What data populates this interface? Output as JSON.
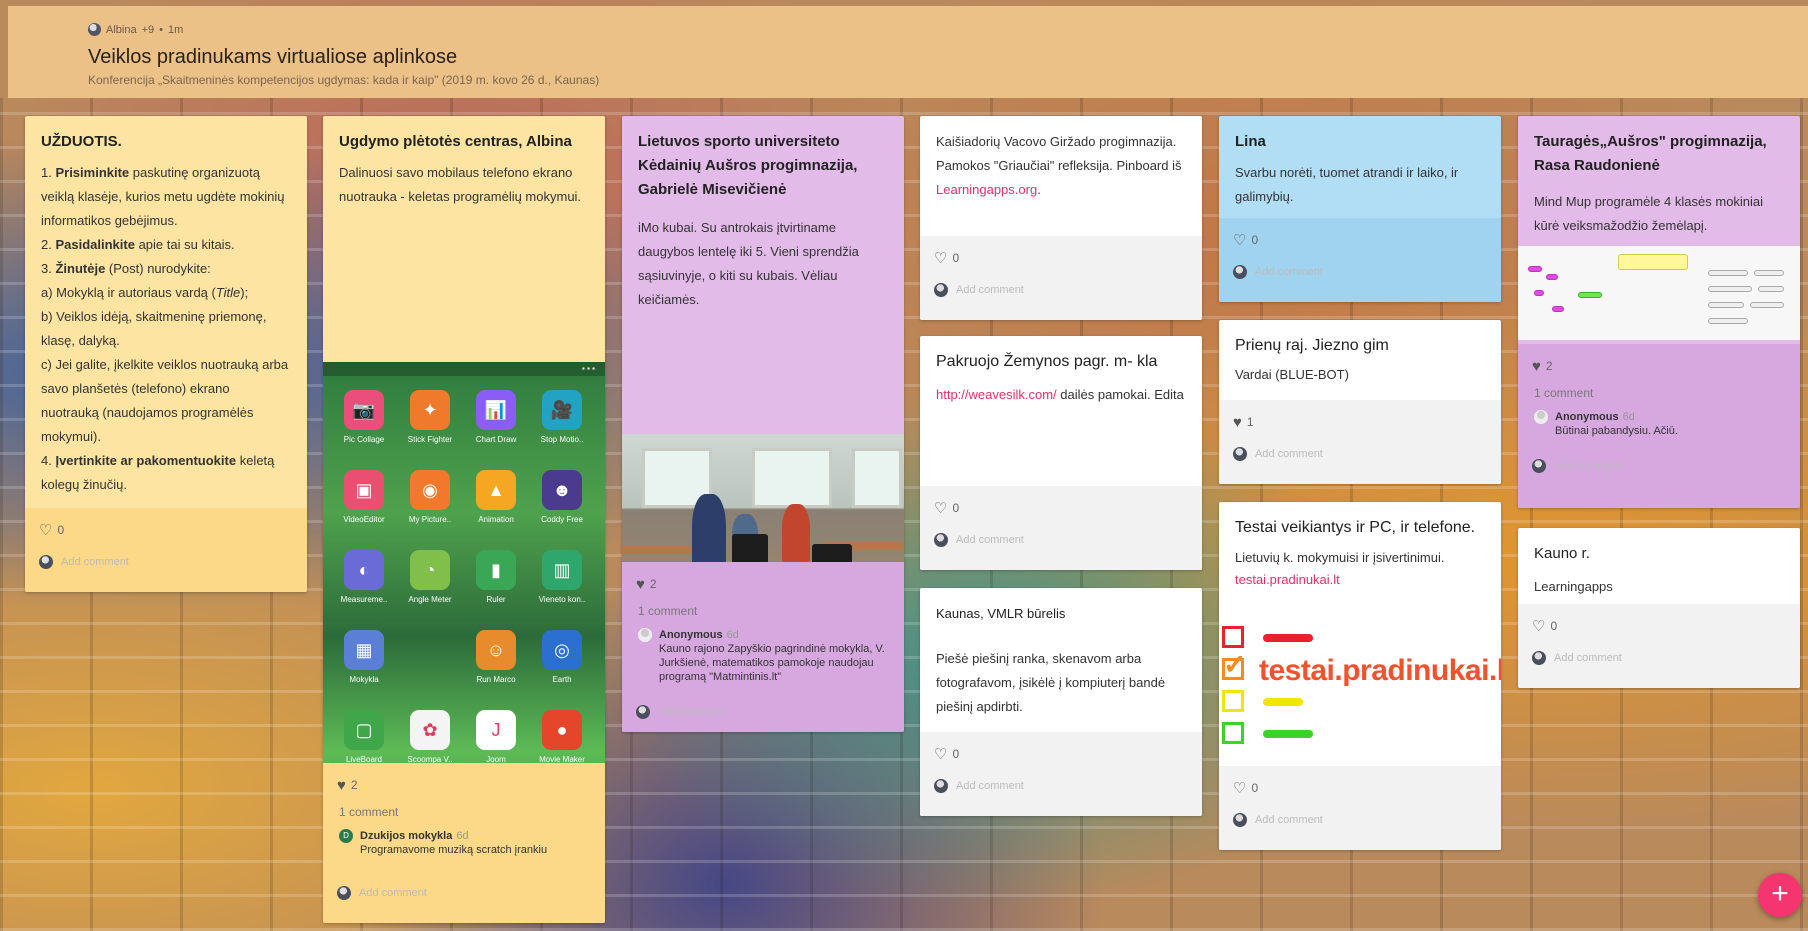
{
  "header": {
    "author": "Albina",
    "contributors": "+9",
    "time": "1m",
    "title": "Veiklos pradinukams virtualiose aplinkose",
    "subtitle": "Konferencija „Skaitmeninės kompetencijos ugdymas: kada ir kaip\" (2019 m. kovo 26 d., Kaunas)"
  },
  "ui": {
    "add_comment": "Add comment",
    "comment_count_one": "1 comment",
    "fab": "+"
  },
  "cards": {
    "task": {
      "title": "UŽDUOTIS.",
      "item1_num": "1. ",
      "item1_bold": "Prisiminkite",
      "item1_rest": " paskutinę organizuotą veiklą klasėje, kurios metu ugdėte mokinių informatikos gebėjimus.",
      "item2_num": "2. ",
      "item2_bold": "Pasidalinkite",
      "item2_rest": " apie tai su kitais.",
      "item3_num": "3. ",
      "item3_bold": "Žinutėje",
      "item3_rest": " (Post) nurodykite:",
      "line_a1": "a) Mokyklą ir autoriaus vardą (",
      "line_a_italic": "Title",
      "line_a2": ");",
      "line_b": "b) Veiklos idėją, skaitmeninę priemonę, klasę, dalyką.",
      "line_c": "c) Jei galite, įkelkite veiklos nuotrauką arba savo planšetės (telefono) ekrano nuotrauką (naudojamos programėlės mokymui).",
      "item4_num": "4. ",
      "item4_bold": "Įvertinkite ar pakomentuokite",
      "item4_rest": " keletą kolegų žinučių.",
      "likes": "0"
    },
    "albina": {
      "title": "Ugdymo plėtotės centras, Albina",
      "body": "Dalinuosi savo mobilaus telefono ekrano nuotrauka - keletas programėlių mokymui.",
      "likes": "2",
      "comment_author": "Dzukijos mokykla",
      "comment_avatar": "D",
      "comment_time": "6d",
      "comment_text": "Programavome muziką scratch įrankiu",
      "apps": [
        {
          "label": "Pic Collage",
          "icon": "📷",
          "color": "#e94f7a"
        },
        {
          "label": "Stick Fighter",
          "icon": "✦",
          "color": "#f07a2b"
        },
        {
          "label": "Chart Draw",
          "icon": "📊",
          "color": "#8b5cf6"
        },
        {
          "label": "Stop Motio..",
          "icon": "🎥",
          "color": "#22a3c4"
        },
        {
          "label": "VideoEditor",
          "icon": "▣",
          "color": "#e84f70"
        },
        {
          "label": "My Picture..",
          "icon": "◉",
          "color": "#f2792b"
        },
        {
          "label": "Animation",
          "icon": "▲",
          "color": "#f5a623"
        },
        {
          "label": "Coddy Free",
          "icon": "☻",
          "color": "#4a3b8f"
        },
        {
          "label": "Measureme..",
          "icon": "◐",
          "color": "#6b6bd8"
        },
        {
          "label": "Angle Meter",
          "icon": "◔",
          "color": "#7fbf4a"
        },
        {
          "label": "Ruler",
          "icon": "▮",
          "color": "#3aa757"
        },
        {
          "label": "Vieneto kon..",
          "icon": "▥",
          "color": "#2fa66b"
        },
        {
          "label": "Mokykla",
          "icon": "▦",
          "color": "#5b7fd6"
        },
        {
          "label": "",
          "icon": "",
          "color": "transparent"
        },
        {
          "label": "Run Marco",
          "icon": "☺",
          "color": "#e88b2c"
        },
        {
          "label": "Earth",
          "icon": "◎",
          "color": "#2b6fd1"
        },
        {
          "label": "LiveBoard",
          "icon": "▢",
          "color": "#3fa64a"
        },
        {
          "label": "Scoompa V..",
          "icon": "✿",
          "color": "#f4f4f4"
        },
        {
          "label": "Joom",
          "icon": "J",
          "color": "#ffffff"
        },
        {
          "label": "Movie Maker",
          "icon": "●",
          "color": "#e5452b"
        }
      ],
      "dock": [
        {
          "icon": "✆",
          "color": "#2fa84f"
        },
        {
          "icon": "✉",
          "color": "#f59c2a"
        },
        {
          "icon": "◈",
          "color": "#2d8ae6"
        }
      ]
    },
    "lsu": {
      "title": "Lietuvos sporto universiteto Kėdainių Aušros progimnazija, Gabrielė Misevičienė",
      "body": " iMo kubai. Su antrokais įtvirtiname daugybos lentelę iki 5. Vieni sprendžia sąsiuvinyje, o kiti su kubais. Vėliau keičiamės.",
      "likes": "2",
      "comment_author": "Anonymous",
      "comment_time": "6d",
      "comment_text": "Kauno rajono Zapyškio pagrindinė mokykla, V. Jurkšienė, matematikos pamokoje naudojau programą \"Matmintinis.lt\""
    },
    "kaisiadoriu": {
      "body_start": "Kaišiadorių Vacovo Giržado progimnazija. Pamokos \"Griaučiai\" refleksija. Pinboard iš ",
      "link": "Learningapps.org",
      "body_end": ".",
      "likes": "0"
    },
    "pakruojo": {
      "title": "Pakruojo Žemynos pagr. m- kla",
      "link": "http://weavesilk.com/",
      "body_rest": " dailės pamokai. Edita",
      "likes": "0"
    },
    "kaunas_vmlr": {
      "title": "Kaunas, VMLR būrelis",
      "body": "Piešė piešinį ranka, skenavom arba fotografavom, įsikėlė į kompiuterį bandė piešinį apdirbti.",
      "likes": "0"
    },
    "lina": {
      "title": "Lina",
      "body": "Svarbu norėti, tuomet atrandi ir laiko, ir galimybių.",
      "likes": "0"
    },
    "prienu": {
      "title": "Prienų raj. Jiezno gim",
      "body": "Vardai (BLUE-BOT)",
      "likes": "1"
    },
    "testai": {
      "title": "Testai veikiantys ir PC, ir telefone.",
      "body": "Lietuvių k. mokymuisi ir įsivertinimui.",
      "link": "testai.pradinukai.lt",
      "logo_text": "testai.pradinukai.lt",
      "likes": "0"
    },
    "taurages": {
      "title": "Tauragės„Aušros\" progimnazija, Rasa Raudonienė",
      "body": "Mind Mup programėle 4 klasės mokiniai kūrė veiksmažodžio žemėlapį.",
      "likes": "2",
      "comment_author": "Anonymous",
      "comment_time": "6d",
      "comment_text": "Būtinai pabandysiu. Ačiū."
    },
    "kauno_r": {
      "title": "Kauno r.",
      "body": "Learningapps",
      "likes": "0"
    }
  },
  "colors": {
    "header_bg": "#ecc187",
    "yellow_card": "#fde4a2",
    "purple_card": "#e2bbe9",
    "blue_card": "#b2def5",
    "accent_pink": "#f4356f"
  }
}
